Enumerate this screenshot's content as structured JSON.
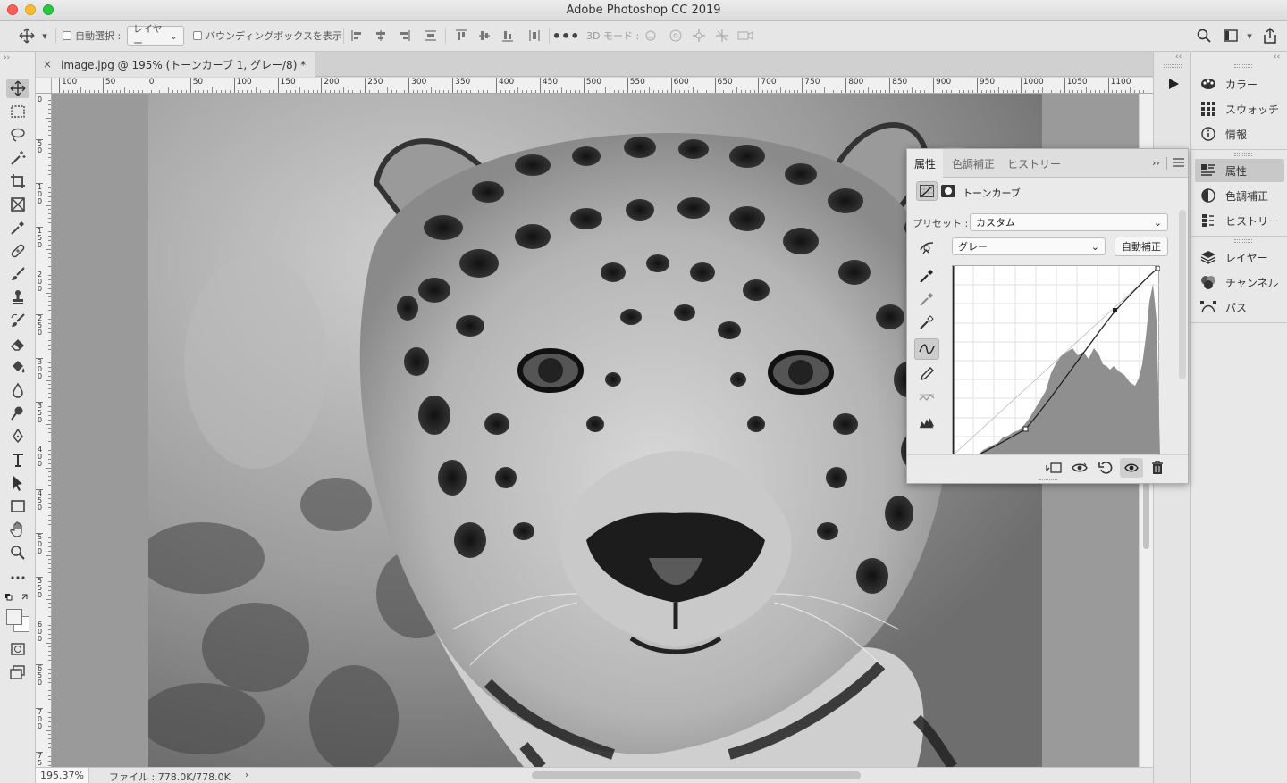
{
  "window": {
    "title": "Adobe Photoshop CC 2019"
  },
  "options_bar": {
    "auto_select_label": "自動選択 :",
    "layer_dropdown": "レイヤー",
    "bounding_box_label": "バウンディングボックスを表示",
    "three_d_mode_label": "3D モード :"
  },
  "document": {
    "tab_label": "image.jpg @ 195% (トーンカーブ 1, グレー/8) *",
    "close_glyph": "×",
    "h_ruler_ticks": [
      "100",
      "50",
      "0",
      "50",
      "100",
      "150",
      "200",
      "250",
      "300",
      "350",
      "400",
      "450",
      "500",
      "550",
      "600",
      "650",
      "700",
      "750",
      "800",
      "850",
      "900",
      "950",
      "1000",
      "1050",
      "1100"
    ],
    "v_ruler_ticks": [
      "0",
      "50",
      "100",
      "150",
      "200",
      "250",
      "300",
      "350",
      "400",
      "450",
      "500",
      "550",
      "600",
      "650",
      "700",
      "750"
    ]
  },
  "status_bar": {
    "zoom": "195.37%",
    "file_info": "ファイル : 778.0K/778.0K",
    "arrow": "›"
  },
  "properties_panel": {
    "tabs": [
      "属性",
      "色調補正",
      "ヒストリー"
    ],
    "active_tab": 0,
    "adjustment_title": "トーンカーブ",
    "preset_label": "プリセット :",
    "preset_value": "カスタム",
    "channel_value": "グレー",
    "auto_button": "自動補正"
  },
  "right_dock": {
    "group1": [
      "カラー",
      "スウォッチ",
      "情報"
    ],
    "group2": [
      "属性",
      "色調補正",
      "ヒストリー"
    ],
    "group3": [
      "レイヤー",
      "チャンネル",
      "パス"
    ],
    "selected": "属性"
  },
  "colors": {
    "panel_bg": "#e8e8e8",
    "selected": "#c8c8c8"
  }
}
